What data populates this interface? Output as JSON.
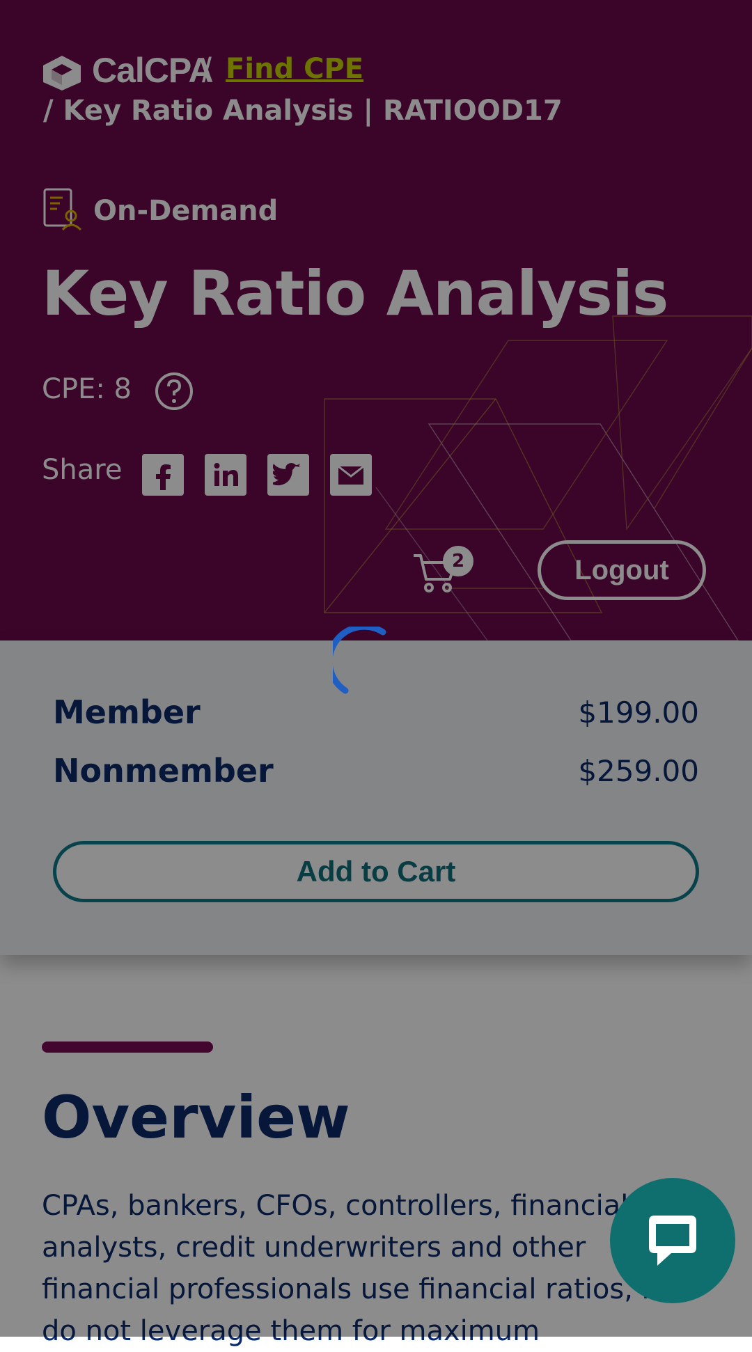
{
  "header": {
    "brand": "CalCPA",
    "separator": "/",
    "find_cpe": "Find CPE",
    "breadcrumb_current": "/ Key Ratio Analysis | RATIOOD17"
  },
  "course": {
    "format": "On-Demand",
    "title": "Key Ratio Analysis",
    "cpe": "CPE: 8",
    "share_label": "Share"
  },
  "cart": {
    "count": "2"
  },
  "logout_label": "Logout",
  "pricing": {
    "rows": [
      {
        "label": "Member",
        "price": "$199.00"
      },
      {
        "label": "Nonmember",
        "price": "$259.00"
      }
    ],
    "add_to_cart": "Add to Cart"
  },
  "overview": {
    "title": "Overview",
    "text": "CPAs, bankers, CFOs, controllers, financial analysts, credit underwriters and other financial professionals use financial ratios, but do not leverage them for maximum"
  },
  "colors": {
    "hero_bg": "#6b0a4b",
    "accent_link": "#c7d600",
    "navy": "#0b2a6b",
    "teal": "#0f7a8a"
  },
  "icons": [
    "calcpa-logo-icon",
    "on-demand-icon",
    "help-icon",
    "facebook-icon",
    "linkedin-icon",
    "twitter-icon",
    "email-icon",
    "cart-icon",
    "loading-spinner-icon",
    "chat-icon"
  ]
}
